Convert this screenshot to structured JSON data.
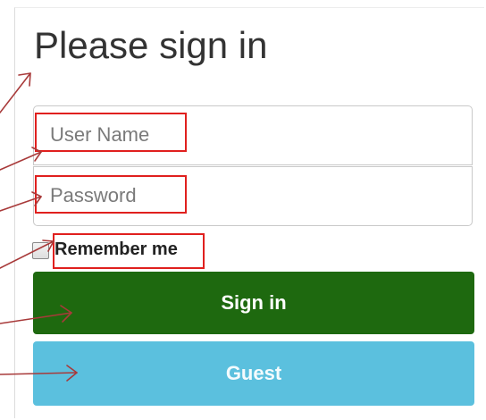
{
  "form": {
    "title": "Please sign in",
    "username_placeholder": "User Name",
    "password_placeholder": "Password",
    "remember_label": "Remember me",
    "signin_label": "Sign in",
    "guest_label": "Guest"
  },
  "colors": {
    "signin_button": "#1e690f",
    "guest_button": "#5bc0de",
    "annotation_highlight": "#e0201e",
    "annotation_arrow": "#a83a3a"
  },
  "annotations": {
    "highlighted_items": [
      "title",
      "username-field",
      "password-field",
      "remember-me",
      "sign-in-button",
      "guest-button"
    ]
  }
}
